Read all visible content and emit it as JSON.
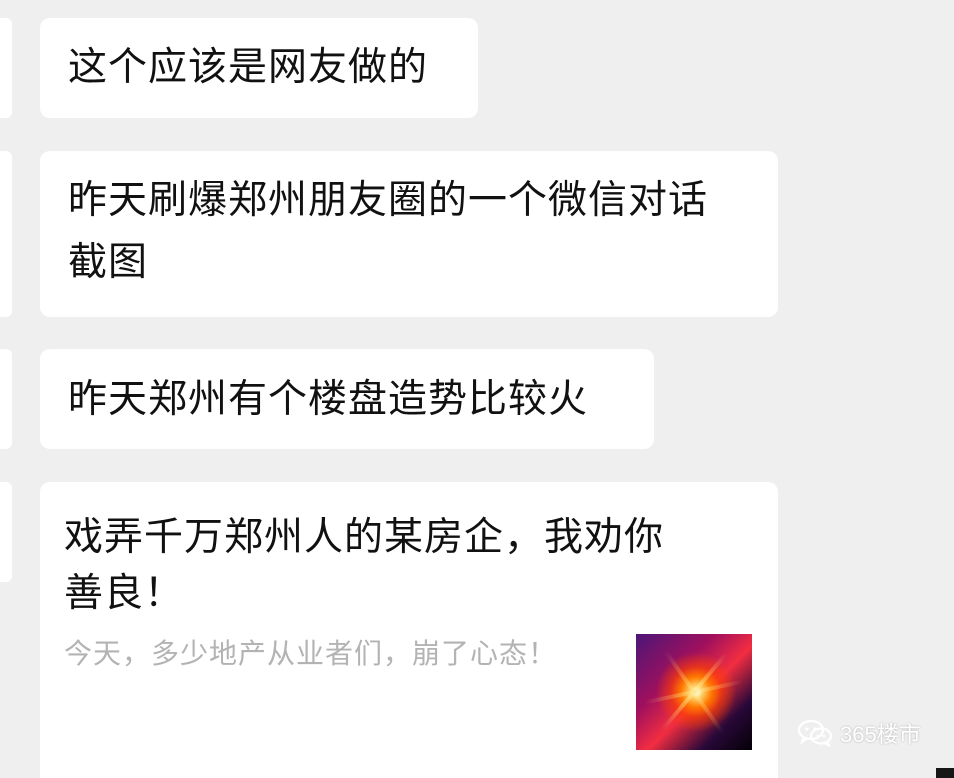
{
  "messages": [
    {
      "text": "这个应该是网友做的"
    },
    {
      "text": "昨天刷爆郑州朋友圈的一个微信对话\n截图"
    },
    {
      "text": "昨天郑州有个楼盘造势比较火"
    }
  ],
  "card": {
    "title": "戏弄千万郑州人的某房企，我劝你\n善良！",
    "description": "今天，多少地产从业者们，崩了心态！",
    "thumbnail": "fireworks-image"
  },
  "watermark": {
    "text": "365楼市",
    "icon": "wechat-icon"
  },
  "colors": {
    "background": "#efefef",
    "bubble": "#ffffff",
    "text": "#111111",
    "muted_text": "#b3b3b3"
  }
}
